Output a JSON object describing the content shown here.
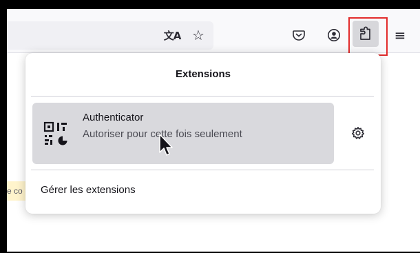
{
  "toolbar": {
    "translate_icon": "文A",
    "star_icon": "☆",
    "menu_icon": "≡"
  },
  "left_strip": {
    "text": "e co"
  },
  "panel": {
    "title": "Extensions",
    "extension": {
      "name": "Authenticator",
      "status": "Autoriser pour cette fois seulement"
    },
    "manage_label": "Gérer les extensions"
  },
  "colors": {
    "highlight": "#e22b2b",
    "row_bg": "#d9d9dd",
    "strip_bg": "#fff4cc"
  }
}
